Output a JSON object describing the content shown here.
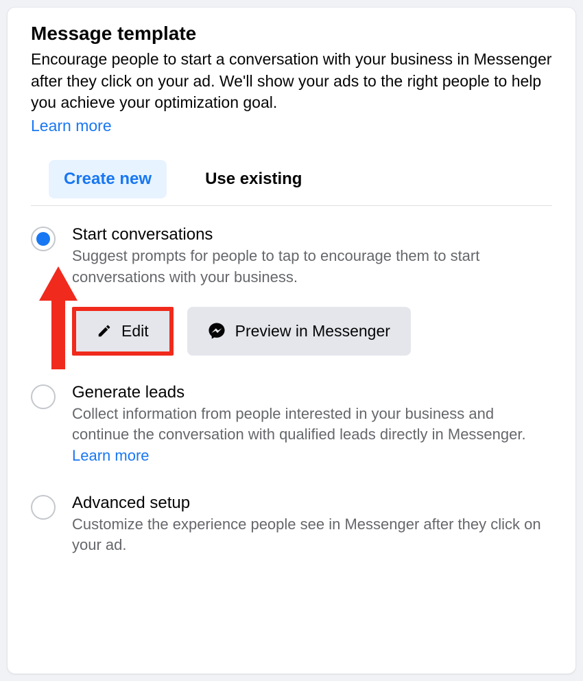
{
  "header": {
    "title": "Message template",
    "description": "Encourage people to start a conversation with your business in Messenger after they click on your ad. We'll show your ads to the right people to help you achieve your optimization goal.",
    "learn_more": "Learn more"
  },
  "tabs": {
    "create_new": "Create new",
    "use_existing": "Use existing"
  },
  "options": {
    "start_conversations": {
      "title": "Start conversations",
      "desc": "Suggest prompts for people to tap to encourage them to start conversations with your business."
    },
    "generate_leads": {
      "title": "Generate leads",
      "desc_pre": "Collect information from people interested in your business and continue the conversation with qualified leads directly in Messenger. ",
      "learn_more": "Learn more"
    },
    "advanced_setup": {
      "title": "Advanced setup",
      "desc": "Customize the experience people see in Messenger after they click on your ad."
    }
  },
  "buttons": {
    "edit": "Edit",
    "preview": "Preview in Messenger"
  }
}
